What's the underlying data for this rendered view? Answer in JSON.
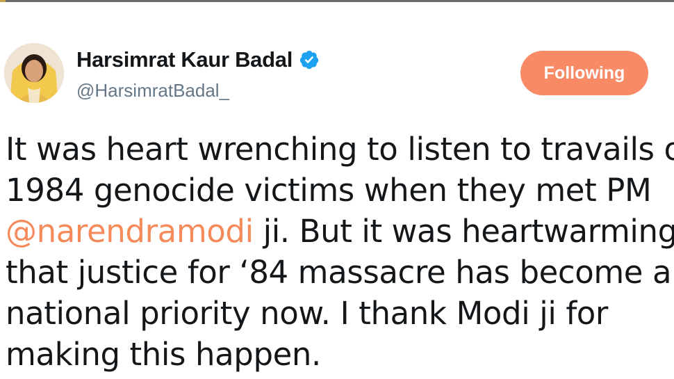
{
  "tweet": {
    "author": {
      "display_name": "Harsimrat Kaur Badal",
      "handle": "@HarsimratBadal_",
      "verified": true
    },
    "follow_button_label": "Following",
    "text_lines": {
      "line1": "It was heart wrenching to listen to travails of",
      "line2": "1984 genocide victims when they met PM",
      "line3_mention": "@narendramodi",
      "line3_rest": " ji. But it was heartwarming",
      "line4": "that justice for ‘84 massacre has become a",
      "line5": "national priority now. I thank Modi ji for",
      "line6": "making this happen."
    }
  },
  "colors": {
    "accent": "#f98a66",
    "mention": "#f58a5b",
    "verified_badge": "#1da1f2",
    "text": "#14171a",
    "secondary_text": "#657786"
  },
  "icons": {
    "verified": "verified-badge-icon",
    "avatar": "user-avatar"
  }
}
